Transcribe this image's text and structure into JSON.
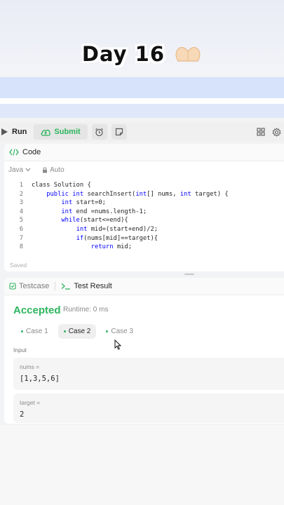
{
  "overlay": {
    "title": "Day 16"
  },
  "toolbar": {
    "run_label": "Run",
    "submit_label": "Submit"
  },
  "editor": {
    "tab_label": "Code",
    "language": "Java",
    "auto_label": "Auto",
    "saved_label": "Saved",
    "lines": [
      {
        "n": "1",
        "text": "class Solution {"
      },
      {
        "n": "2",
        "text": "    public int searchInsert(int[] nums, int target) {"
      },
      {
        "n": "3",
        "text": "        int start=0;"
      },
      {
        "n": "4",
        "text": "        int end =nums.length-1;"
      },
      {
        "n": "5",
        "text": "        while(start<=end){"
      },
      {
        "n": "6",
        "text": "            int mid=(start+end)/2;"
      },
      {
        "n": "7",
        "text": "            if(nums[mid]==target){"
      },
      {
        "n": "8",
        "text": "                return mid;"
      }
    ]
  },
  "result": {
    "testcase_tab": "Testcase",
    "result_tab": "Test Result",
    "status": "Accepted",
    "runtime": "Runtime: 0 ms",
    "cases": [
      "Case 1",
      "Case 2",
      "Case 3"
    ],
    "active_case": "Case 2",
    "input_label": "Input",
    "inputs": [
      {
        "name": "nums =",
        "value": "[1,3,5,6]"
      },
      {
        "name": "target =",
        "value": "2"
      }
    ]
  },
  "colors": {
    "accent_green": "#2db55d",
    "keyword_blue": "#0000ff"
  }
}
